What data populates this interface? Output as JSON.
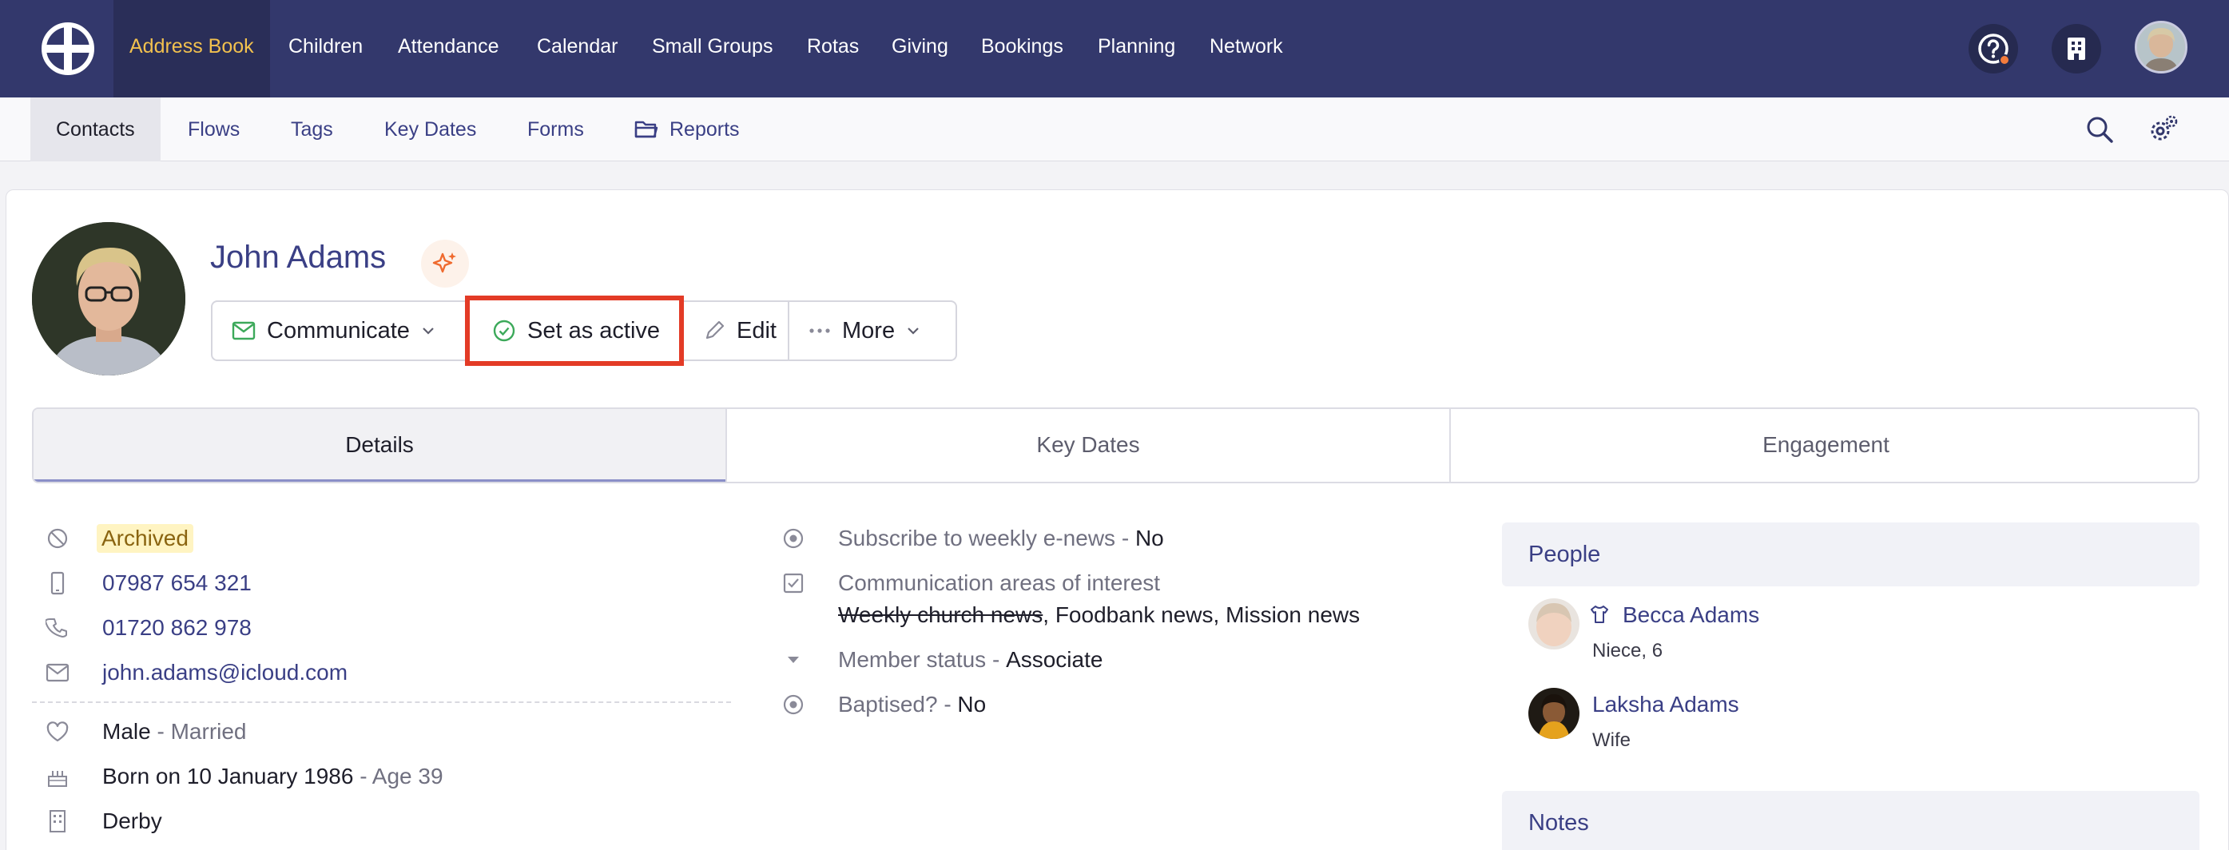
{
  "nav": {
    "items": [
      "Address Book",
      "Children",
      "Attendance",
      "Calendar",
      "Small Groups",
      "Rotas",
      "Giving",
      "Bookings",
      "Planning",
      "Network"
    ],
    "active": "Address Book",
    "icons": [
      "help-icon",
      "building-icon",
      "user-avatar"
    ]
  },
  "subnav": {
    "items": [
      "Contacts",
      "Flows",
      "Tags",
      "Key Dates",
      "Forms",
      "Reports"
    ],
    "active": "Contacts",
    "icons": [
      "search-icon",
      "settings-icon"
    ]
  },
  "contact": {
    "name": "John Adams"
  },
  "actions": {
    "communicate": "Communicate",
    "set_active": "Set as active",
    "edit": "Edit",
    "more": "More"
  },
  "tabs": [
    "Details",
    "Key Dates",
    "Engagement"
  ],
  "details": {
    "status": "Archived",
    "mobile": "07987 654 321",
    "phone": "01720 862 978",
    "email": "john.adams@icloud.com",
    "gender": "Male",
    "marital_sep": " - ",
    "marital": "Married",
    "born": "Born on 10 January 1986",
    "age": " - Age 39",
    "location": "Derby"
  },
  "fields": {
    "enews_label": "Subscribe to weekly e-news - ",
    "enews_value": "No",
    "interest_label": "Communication areas of interest",
    "interest_struck": "Weekly church news",
    "interest_rest": ", Foodbank news, Mission news",
    "member_label": "Member status - ",
    "member_value": "Associate",
    "baptised_label": "Baptised? - ",
    "baptised_value": "No"
  },
  "people": {
    "heading": "People",
    "list": [
      {
        "name": "Becca Adams",
        "relation": "Niece, 6"
      },
      {
        "name": "Laksha Adams",
        "relation": "Wife"
      }
    ]
  },
  "notes": {
    "heading": "Notes"
  },
  "colors": {
    "nav_bg": "#33386c",
    "accent": "#3a3f85",
    "highlight": "#e33b26",
    "active_nav": "#f2c14e"
  }
}
